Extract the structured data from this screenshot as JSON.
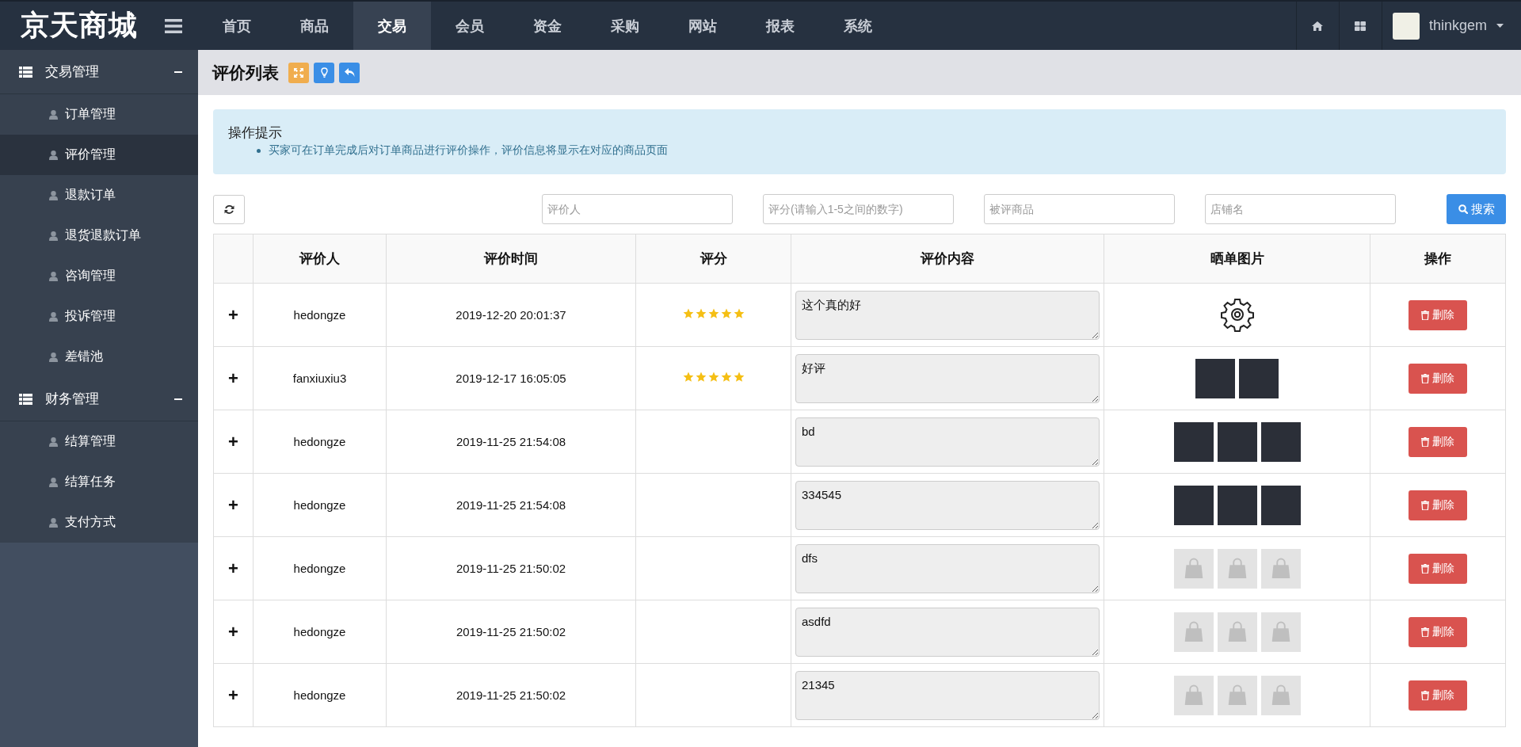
{
  "brand": "京天商城",
  "nav": [
    {
      "label": "首页",
      "selected": false
    },
    {
      "label": "商品",
      "selected": false
    },
    {
      "label": "交易",
      "selected": true
    },
    {
      "label": "会员",
      "selected": false
    },
    {
      "label": "资金",
      "selected": false
    },
    {
      "label": "采购",
      "selected": false
    },
    {
      "label": "网站",
      "selected": false
    },
    {
      "label": "报表",
      "selected": false
    },
    {
      "label": "系统",
      "selected": false
    }
  ],
  "user": {
    "name": "thinkgem"
  },
  "sidebar": [
    {
      "title": "交易管理",
      "expanded": true,
      "items": [
        {
          "label": "订单管理",
          "selected": false
        },
        {
          "label": "评价管理",
          "selected": true
        },
        {
          "label": "退款订单",
          "selected": false
        },
        {
          "label": "退货退款订单",
          "selected": false
        },
        {
          "label": "咨询管理",
          "selected": false
        },
        {
          "label": "投诉管理",
          "selected": false
        },
        {
          "label": "差错池",
          "selected": false
        }
      ]
    },
    {
      "title": "财务管理",
      "expanded": true,
      "items": [
        {
          "label": "结算管理",
          "selected": false
        },
        {
          "label": "结算任务",
          "selected": false
        },
        {
          "label": "支付方式",
          "selected": false
        }
      ]
    }
  ],
  "page_title": "评价列表",
  "tip": {
    "title": "操作提示",
    "items": [
      "买家可在订单完成后对订单商品进行评价操作，评价信息将显示在对应的商品页面"
    ]
  },
  "filters": [
    {
      "placeholder": "评价人"
    },
    {
      "placeholder": "评分(请输入1-5之间的数字)"
    },
    {
      "placeholder": "被评商品"
    },
    {
      "placeholder": "店铺名"
    }
  ],
  "search_button": "搜索",
  "table": {
    "columns": [
      "评价人",
      "评价时间",
      "评分",
      "评价内容",
      "晒单图片",
      "操作"
    ],
    "rows": [
      {
        "toggle": "+",
        "user": "hedongze",
        "time": "2019-12-20 20:01:37",
        "stars": 5,
        "content": "这个真的好",
        "images": [
          {
            "kind": "gear"
          }
        ],
        "action": "删除"
      },
      {
        "toggle": "+",
        "user": "fanxiuxiu3",
        "time": "2019-12-17 16:05:05",
        "stars": 5,
        "content": "好评",
        "images": [
          {
            "kind": "photo"
          },
          {
            "kind": "photo"
          }
        ],
        "action": "删除"
      },
      {
        "toggle": "+",
        "user": "hedongze",
        "time": "2019-11-25 21:54:08",
        "content": "bd",
        "images": [
          {
            "kind": "photo"
          },
          {
            "kind": "photo"
          },
          {
            "kind": "photo"
          }
        ],
        "action": "删除"
      },
      {
        "toggle": "+",
        "user": "hedongze",
        "time": "2019-11-25 21:54:08",
        "content": "334545",
        "images": [
          {
            "kind": "photo"
          },
          {
            "kind": "photo"
          },
          {
            "kind": "photo"
          }
        ],
        "action": "删除"
      },
      {
        "toggle": "+",
        "user": "hedongze",
        "time": "2019-11-25 21:50:02",
        "content": "dfs",
        "images": [
          {
            "kind": "placeholder"
          },
          {
            "kind": "placeholder"
          },
          {
            "kind": "placeholder"
          }
        ],
        "action": "删除"
      },
      {
        "toggle": "+",
        "user": "hedongze",
        "time": "2019-11-25 21:50:02",
        "content": "asdfd",
        "images": [
          {
            "kind": "placeholder"
          },
          {
            "kind": "placeholder"
          },
          {
            "kind": "placeholder"
          }
        ],
        "action": "删除"
      },
      {
        "toggle": "+",
        "user": "hedongze",
        "time": "2019-11-25 21:50:02",
        "content": "21345",
        "images": [
          {
            "kind": "placeholder"
          },
          {
            "kind": "placeholder"
          },
          {
            "kind": "placeholder"
          }
        ],
        "action": "删除"
      }
    ]
  }
}
